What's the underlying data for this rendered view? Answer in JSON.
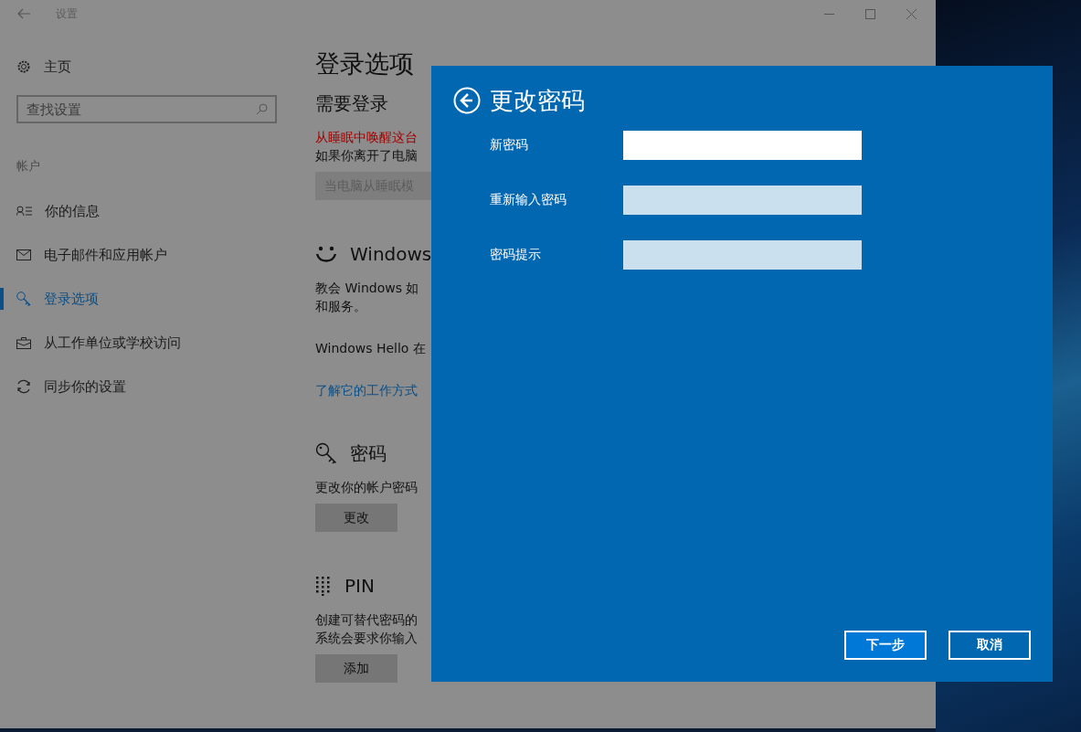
{
  "window": {
    "title": "设置"
  },
  "sidebar": {
    "home": "主页",
    "search": {
      "placeholder": "查找设置"
    },
    "section": "帐户",
    "items": [
      {
        "label": "你的信息",
        "selected": false
      },
      {
        "label": "电子邮件和应用帐户",
        "selected": false
      },
      {
        "label": "登录选项",
        "selected": true
      },
      {
        "label": "从工作单位或学校访问",
        "selected": false
      },
      {
        "label": "同步你的设置",
        "selected": false
      }
    ]
  },
  "content": {
    "title": "登录选项",
    "sections": [
      {
        "heading": "需要登录",
        "lines": [
          {
            "text": "从睡眠中唤醒这台",
            "kind": "warning"
          },
          {
            "text": "如果你离开了电脑",
            "kind": "plain"
          }
        ],
        "button": {
          "label": "当电脑从睡眠模",
          "disabled": true
        }
      },
      {
        "heading": "Windows",
        "lines": [
          {
            "text": "教会 Windows 如",
            "kind": "plain"
          },
          {
            "text": "和服务。",
            "kind": "plain"
          },
          {
            "text": "Windows Hello 在",
            "kind": "gap"
          },
          {
            "text": "了解它的工作方式",
            "kind": "link"
          }
        ]
      },
      {
        "heading": "密码",
        "lines": [
          {
            "text": "更改你的帐户密码",
            "kind": "plain"
          }
        ],
        "button": {
          "label": "更改",
          "disabled": false
        }
      },
      {
        "heading": "PIN",
        "lines": [
          {
            "text": "创建可替代密码的",
            "kind": "plain"
          },
          {
            "text": "系统会要求你输入",
            "kind": "plain"
          }
        ],
        "button": {
          "label": "添加",
          "disabled": false
        }
      }
    ]
  },
  "dialog": {
    "title": "更改密码",
    "fields": [
      {
        "label": "新密码",
        "focused": true
      },
      {
        "label": "重新输入密码",
        "focused": false
      },
      {
        "label": "密码提示",
        "focused": false
      }
    ],
    "buttons": [
      {
        "label": "下一步",
        "kind": "primary"
      },
      {
        "label": "取消",
        "kind": "secondary"
      }
    ]
  }
}
